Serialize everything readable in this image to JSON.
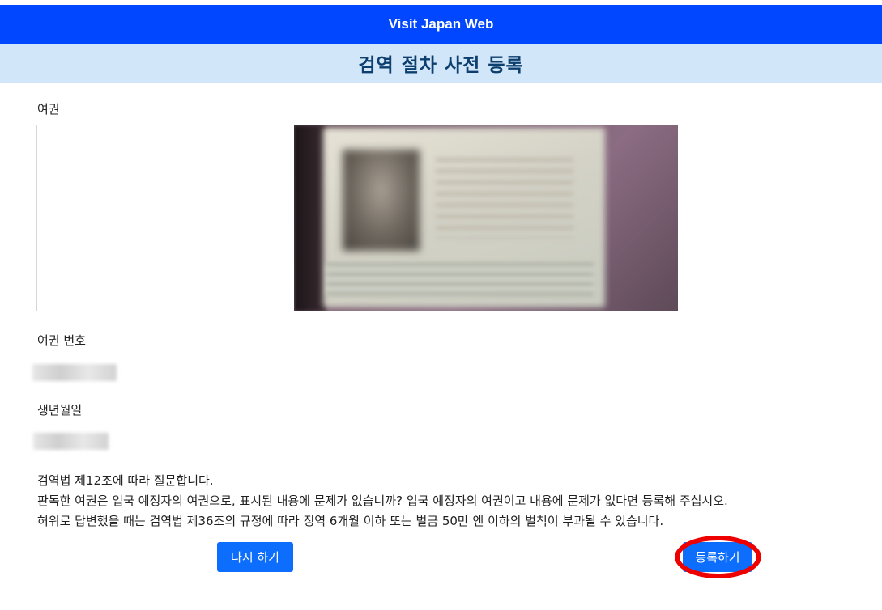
{
  "header": {
    "app_title": "Visit Japan Web",
    "page_title": "검역 절차 사전 등록"
  },
  "form": {
    "passport_label": "여권",
    "passport_number_label": "여권 번호",
    "birthdate_label": "생년월일"
  },
  "notice": {
    "lines": [
      "검역법 제12조에 따라 질문합니다.",
      "판독한 여권은 입국 예정자의 여권으로, 표시된 내용에 문제가 없습니까? 입국 예정자의 여권이고 내용에 문제가 없다면 등록해 주십시오.",
      "허위로 답변했을 때는 검역법 제36조의 규정에 따라 징역 6개월 이하 또는 벌금 50만 엔 이하의 벌칙이 부과될 수 있습니다."
    ]
  },
  "buttons": {
    "retry": "다시 하기",
    "register": "등록하기"
  },
  "colors": {
    "header_bg": "#0047ff",
    "subheader_bg": "#d2e6f9",
    "subheader_text": "#0c3e6e",
    "button_bg": "#0d6efd",
    "highlight": "#ee0000"
  }
}
